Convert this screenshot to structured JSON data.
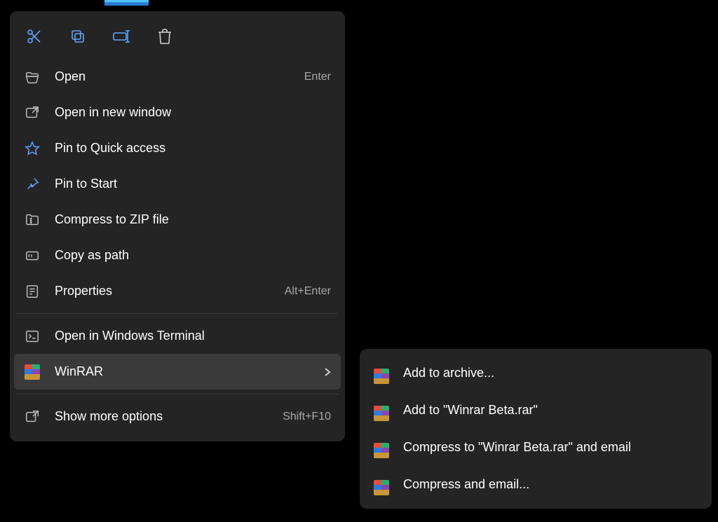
{
  "menu": {
    "open": {
      "label": "Open",
      "shortcut": "Enter"
    },
    "open_new_window": {
      "label": "Open in new window"
    },
    "pin_quick": {
      "label": "Pin to Quick access"
    },
    "pin_start": {
      "label": "Pin to Start"
    },
    "compress_zip": {
      "label": "Compress to ZIP file"
    },
    "copy_path": {
      "label": "Copy as path"
    },
    "properties": {
      "label": "Properties",
      "shortcut": "Alt+Enter"
    },
    "open_terminal": {
      "label": "Open in Windows Terminal"
    },
    "winrar": {
      "label": "WinRAR"
    },
    "show_more": {
      "label": "Show more options",
      "shortcut": "Shift+F10"
    }
  },
  "submenu": {
    "add_archive": "Add to archive...",
    "add_named": "Add to \"Winrar Beta.rar\"",
    "compress_email": "Compress to \"Winrar Beta.rar\" and email",
    "compress_email_dlg": "Compress and email..."
  }
}
